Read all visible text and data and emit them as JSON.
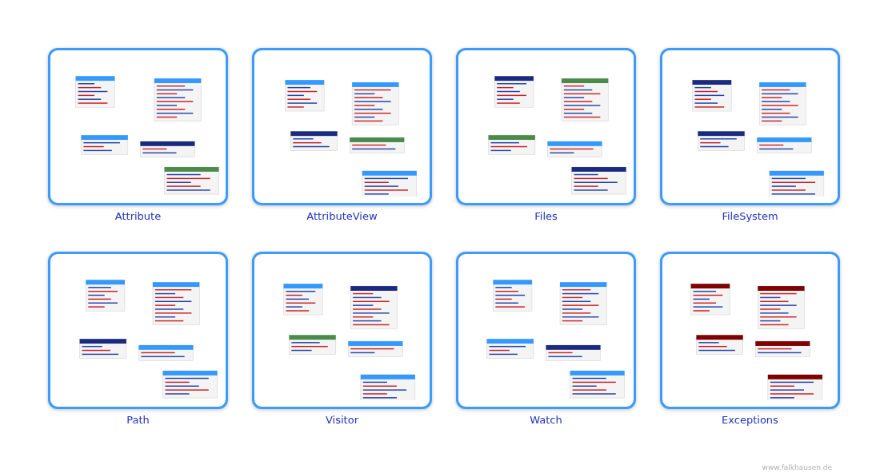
{
  "gallery": [
    {
      "caption": "Attribute"
    },
    {
      "caption": "AttributeView"
    },
    {
      "caption": "Files"
    },
    {
      "caption": "FileSystem"
    },
    {
      "caption": "Path"
    },
    {
      "caption": "Visitor"
    },
    {
      "caption": "Watch"
    },
    {
      "caption": "Exceptions"
    }
  ],
  "footer": {
    "credit": "www.falkhausen.de"
  }
}
